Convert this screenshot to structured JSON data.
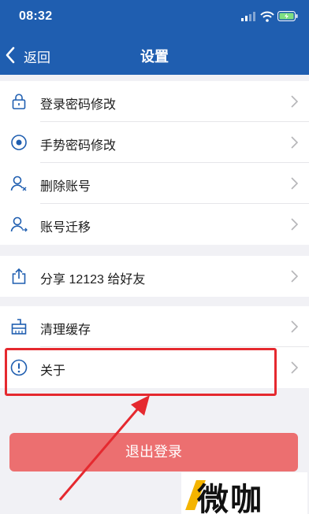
{
  "status_bar": {
    "time": "08:32"
  },
  "nav": {
    "back_label": "返回",
    "title": "设置"
  },
  "groups": [
    {
      "items": [
        {
          "icon": "lock-icon",
          "label": "登录密码修改"
        },
        {
          "icon": "gesture-icon",
          "label": "手势密码修改"
        },
        {
          "icon": "user-delete-icon",
          "label": "删除账号"
        },
        {
          "icon": "user-migrate-icon",
          "label": "账号迁移"
        }
      ]
    },
    {
      "items": [
        {
          "icon": "share-icon",
          "label": "分享 12123 给好友"
        }
      ]
    },
    {
      "items": [
        {
          "icon": "broom-icon",
          "label": "清理缓存"
        },
        {
          "icon": "info-icon",
          "label": "关于"
        }
      ]
    }
  ],
  "logout_label": "退出登录",
  "watermark_text": "微咖",
  "colors": {
    "header": "#1f5eb0",
    "logout": "#ec6f70",
    "annotation": "#e5292f",
    "watermark_accent": "#f4b400"
  }
}
